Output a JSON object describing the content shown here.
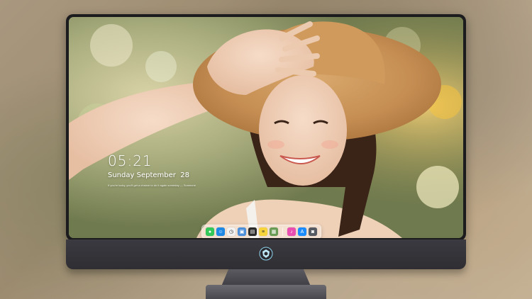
{
  "lock_screen": {
    "time": "05:21",
    "date": "Sunday September  28",
    "quote": "If you're lucky, you'll get a chance to do it again someday — Someone"
  },
  "dock": {
    "apps": [
      {
        "name": "messages-icon",
        "glyph": "●",
        "color": "#34c759"
      },
      {
        "name": "finder-icon",
        "glyph": "☺",
        "color": "#1e88e5"
      },
      {
        "name": "clock-icon",
        "glyph": "◷",
        "color": "#f2f2f2"
      },
      {
        "name": "preview-icon",
        "glyph": "▣",
        "color": "#4d8fd8"
      },
      {
        "name": "claquette-icon",
        "glyph": "▤",
        "color": "#2b2b2b"
      },
      {
        "name": "notes-icon",
        "glyph": "≡",
        "color": "#f7d33c"
      },
      {
        "name": "image-capture-icon",
        "glyph": "▦",
        "color": "#6a9c55"
      }
    ],
    "apps_right": [
      {
        "name": "music-icon",
        "glyph": "♪",
        "color": "#e84fb0"
      },
      {
        "name": "app-store-icon",
        "glyph": "A",
        "color": "#1a8cff"
      },
      {
        "name": "screenshot-icon",
        "glyph": "◙",
        "color": "#555a63"
      }
    ]
  },
  "colors": {
    "bezel": "#1c1c1f",
    "chin": "#34333a",
    "dock_bg": "rgba(255,255,255,0.35)"
  }
}
